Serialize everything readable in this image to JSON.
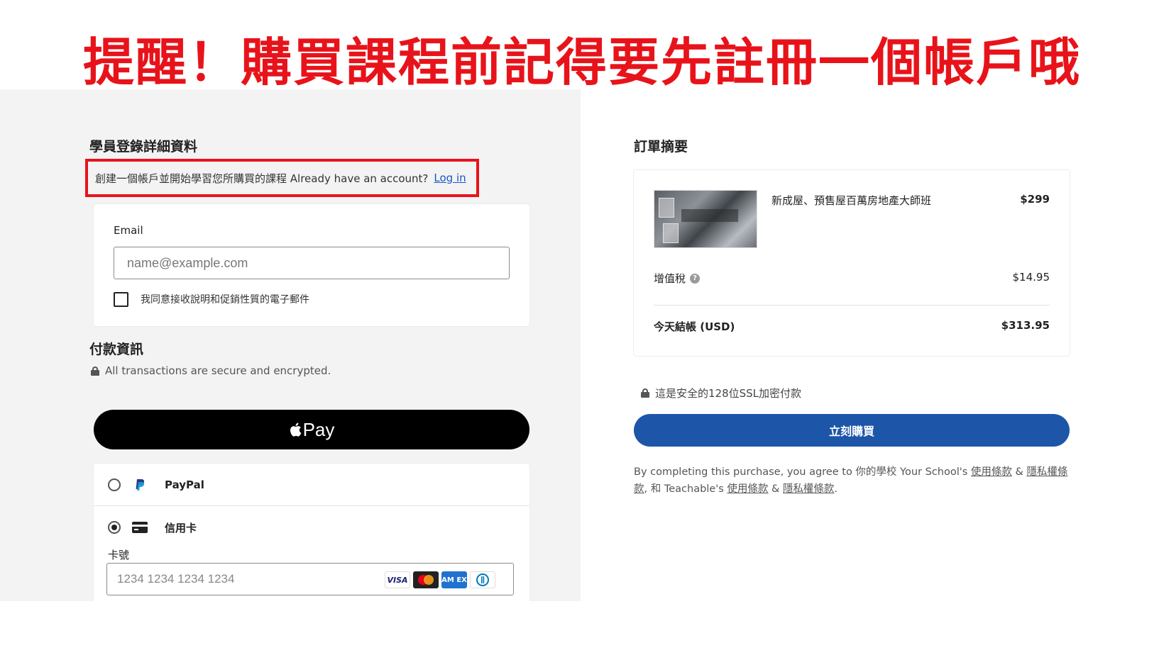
{
  "banner": {
    "text": "提醒！購買課程前記得要先註冊一個帳戶哦",
    "color": "#e8131a"
  },
  "student": {
    "heading": "學員登錄詳細資料",
    "prompt_text": "創建一個帳戶並開始學習您所購買的課程 Already have an account?",
    "login_link": "Log in",
    "email_label": "Email",
    "email_placeholder": "name@example.com",
    "email_value": "",
    "consent_label": "我同意接收說明和促銷性質的電子郵件",
    "consent_checked": false
  },
  "payment": {
    "heading": "付款資訊",
    "secure_text": "All transactions are secure and encrypted.",
    "apple_pay_label": "Pay",
    "methods": [
      {
        "label": "PayPal",
        "icon": "paypal-icon",
        "selected": false
      },
      {
        "label": "信用卡",
        "icon": "credit-card-icon",
        "selected": true
      }
    ],
    "card_number_label": "卡號",
    "card_number_placeholder": "1234 1234 1234 1234",
    "card_brands": [
      "visa-icon",
      "mastercard-icon",
      "amex-icon",
      "diners-icon"
    ],
    "card_brand_text": {
      "visa": "VISA",
      "amex": "AM EX"
    }
  },
  "summary": {
    "heading": "訂單摘要",
    "item_name": "新成屋、預售屋百萬房地產大師班",
    "item_price": "$299",
    "tax_label": "增值稅",
    "tax_value": "$14.95",
    "total_label": "今天結帳 (USD)",
    "total_value": "$313.95"
  },
  "checkout": {
    "secure_text": "這是安全的128位SSL加密付款",
    "buy_label": "立刻購買",
    "accent": "#1d56a9"
  },
  "terms": {
    "intro": "By completing this purchase, you agree to 你的學校 Your School's",
    "school_terms": "使用條款",
    "amp1": "&",
    "school_privacy": "隱私權條款",
    "mid": ", 和 Teachable's",
    "teachable_terms": "使用條款",
    "amp2": "&",
    "teachable_privacy": "隱私權條款",
    "end": "."
  }
}
